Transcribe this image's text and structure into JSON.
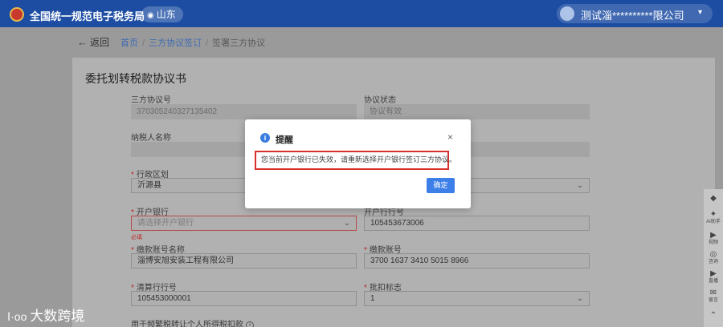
{
  "header": {
    "site_title": "全国统一规范电子税务局",
    "region": "山东",
    "user_name": "测试淄**********限公司"
  },
  "breadcrumb": {
    "back_label": "返回",
    "items": [
      "首页",
      "三方协议签订",
      "签署三方协议"
    ]
  },
  "form": {
    "title": "委托划转税款协议书",
    "fields": {
      "agreement_no": {
        "label": "三方协议号",
        "value": "370305240327135402"
      },
      "agreement_status": {
        "label": "协议状态",
        "value": "协议有效"
      },
      "taxpayer_name": {
        "label": "纳税人名称",
        "value": ""
      },
      "admin_region": {
        "label": "行政区划",
        "value": "沂源县"
      },
      "open_bank": {
        "label": "开户银行",
        "placeholder": "请选择开户银行",
        "error": "必填"
      },
      "open_bank_no": {
        "label": "开户行行号",
        "value": "105453673006"
      },
      "account_name": {
        "label": "缴款账号名称",
        "value": "淄博安旭安装工程有限公司"
      },
      "account_no": {
        "label": "缴款账号",
        "value": "3700 1637 3410 5015 8966"
      },
      "clearing_bank_no": {
        "label": "清算行行号",
        "value": "105453000001"
      },
      "batch_flag": {
        "label": "批扣标志",
        "value": "1"
      },
      "personal_tax_label": "用于频繁税转让个人所得税扣款"
    }
  },
  "modal": {
    "title": "提醒",
    "message": "您当前开户银行已失效，请重新选择开户银行签订三方协议。",
    "ok_label": "确定",
    "close_glyph": "×",
    "info_glyph": "i"
  },
  "side_rail": {
    "items": [
      {
        "icon": "chat-bubble-icon",
        "glyph": "◆",
        "label": ""
      },
      {
        "icon": "ai-assistant-icon",
        "glyph": "✦",
        "label": "AI助手"
      },
      {
        "icon": "video-icon",
        "glyph": "▶",
        "label": "视频"
      },
      {
        "icon": "headset-icon",
        "glyph": "◎",
        "label": "咨询"
      },
      {
        "icon": "play-icon",
        "glyph": "▶",
        "label": "直播"
      },
      {
        "icon": "message-icon",
        "glyph": "✉",
        "label": "留言"
      },
      {
        "icon": "top-icon",
        "glyph": "⌃",
        "label": ""
      }
    ]
  },
  "watermark": {
    "text": "大数跨境",
    "mark": "Ⅰ·ᴏᴏ"
  },
  "colors": {
    "header_bg": "#1c4da3",
    "primary_button": "#3d7fe8",
    "highlight_border": "#d9302c",
    "error_text": "#c02a2a"
  }
}
